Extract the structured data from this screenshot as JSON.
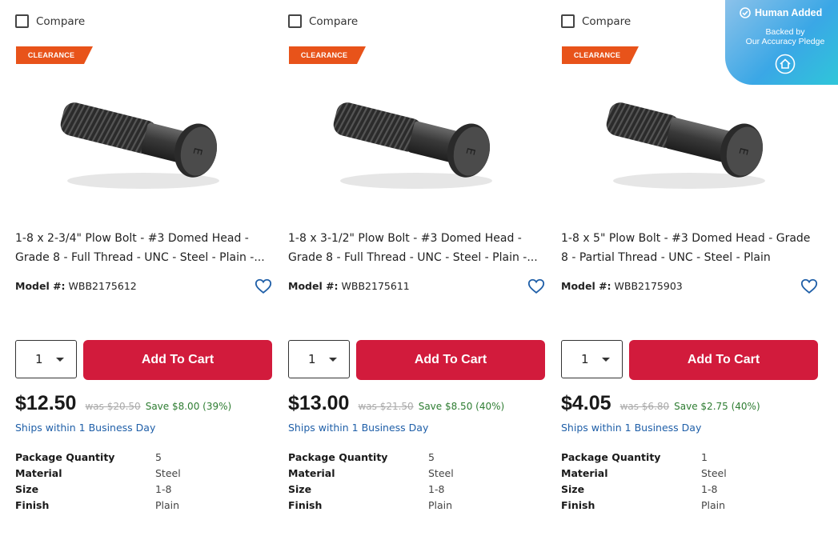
{
  "accent": "#d21b3c",
  "badge_color": "#e8531a",
  "pledge": {
    "title": "Human Added",
    "line1": "Backed by",
    "line2": "Our Accuracy Pledge",
    "check_icon": "check-circle-icon",
    "seal_icon": "house-seal-icon"
  },
  "products": [
    {
      "compare_label": "Compare",
      "badge": "CLEARANCE",
      "title": "1-8 x 2-3/4\" Plow Bolt - #3 Domed Head - Grade 8 - Full Thread - UNC - Steel - Plain -...",
      "model_label": "Model #:",
      "model": "WBB2175612",
      "qty": "1",
      "cart_label": "Add To Cart",
      "price": "$12.50",
      "was": "was $20.50",
      "save": "Save $8.00 (39%)",
      "ships": "Ships within 1 Business Day",
      "specs": [
        {
          "k": "Package Quantity",
          "v": "5"
        },
        {
          "k": "Material",
          "v": "Steel"
        },
        {
          "k": "Size",
          "v": "1-8"
        },
        {
          "k": "Finish",
          "v": "Plain"
        }
      ]
    },
    {
      "compare_label": "Compare",
      "badge": "CLEARANCE",
      "title": "1-8 x 3-1/2\" Plow Bolt - #3 Domed Head - Grade 8 - Full Thread - UNC - Steel - Plain -...",
      "model_label": "Model #:",
      "model": "WBB2175611",
      "qty": "1",
      "cart_label": "Add To Cart",
      "price": "$13.00",
      "was": "was $21.50",
      "save": "Save $8.50 (40%)",
      "ships": "Ships within 1 Business Day",
      "specs": [
        {
          "k": "Package Quantity",
          "v": "5"
        },
        {
          "k": "Material",
          "v": "Steel"
        },
        {
          "k": "Size",
          "v": "1-8"
        },
        {
          "k": "Finish",
          "v": "Plain"
        }
      ]
    },
    {
      "compare_label": "Compare",
      "badge": "CLEARANCE",
      "title": "1-8 x 5\" Plow Bolt - #3 Domed Head - Grade 8 - Partial Thread - UNC - Steel - Plain",
      "model_label": "Model #:",
      "model": "WBB2175903",
      "qty": "1",
      "cart_label": "Add To Cart",
      "price": "$4.05",
      "was": "was $6.80",
      "save": "Save $2.75 (40%)",
      "ships": "Ships within 1 Business Day",
      "specs": [
        {
          "k": "Package Quantity",
          "v": "1"
        },
        {
          "k": "Material",
          "v": "Steel"
        },
        {
          "k": "Size",
          "v": "1-8"
        },
        {
          "k": "Finish",
          "v": "Plain"
        }
      ]
    }
  ]
}
